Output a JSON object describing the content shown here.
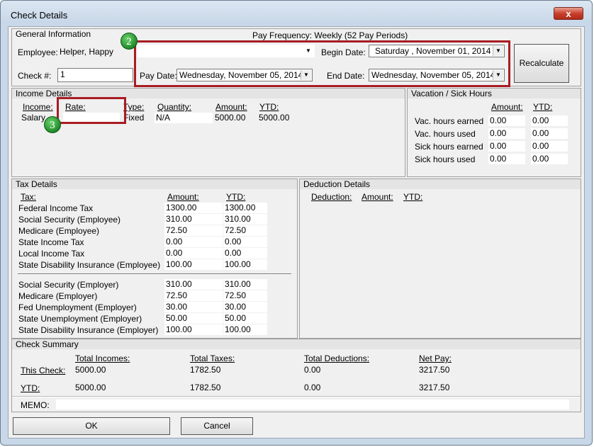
{
  "window": {
    "title": "Check Details",
    "close_glyph": "x"
  },
  "general": {
    "header": "General Information",
    "pay_frequency": "Pay Frequency: Weekly (52 Pay Periods)",
    "employee_label": "Employee:",
    "employee_value": "Helper, Happy",
    "check_label": "Check #:",
    "check_value": "1",
    "begin_date_label": "Begin Date:",
    "begin_date_value": "Saturday , November 01, 2014",
    "pay_date_label": "Pay Date:",
    "pay_date_value": "Wednesday, November 05, 2014",
    "end_date_label": "End Date:",
    "end_date_value": "Wednesday, November 05, 2014",
    "recalculate_label": "Recalculate"
  },
  "annotations": {
    "badge_2": "2",
    "badge_3": "3"
  },
  "income": {
    "header": "Income Details",
    "columns": {
      "income": "Income:",
      "rate": "Rate:",
      "type": "Type:",
      "quantity": "Quantity:",
      "amount": "Amount:",
      "ytd": "YTD:"
    },
    "row": {
      "income": "Salary",
      "rate": "",
      "type": "Fixed",
      "quantity": "N/A",
      "amount": "5000.00",
      "ytd": "5000.00"
    }
  },
  "vacation": {
    "header": "Vacation / Sick Hours",
    "columns": {
      "amount": "Amount:",
      "ytd": "YTD:"
    },
    "rows": [
      {
        "label": "Vac. hours earned",
        "amount": "0.00",
        "ytd": "0.00"
      },
      {
        "label": "Vac. hours used",
        "amount": "0.00",
        "ytd": "0.00"
      },
      {
        "label": "Sick hours earned",
        "amount": "0.00",
        "ytd": "0.00"
      },
      {
        "label": "Sick hours used",
        "amount": "0.00",
        "ytd": "0.00"
      }
    ]
  },
  "tax": {
    "header": "Tax Details",
    "columns": {
      "tax": "Tax:",
      "amount": "Amount:",
      "ytd": "YTD:"
    },
    "employee_rows": [
      {
        "label": "Federal Income Tax",
        "amount": "1300.00",
        "ytd": "1300.00"
      },
      {
        "label": "Social Security (Employee)",
        "amount": "310.00",
        "ytd": "310.00"
      },
      {
        "label": "Medicare (Employee)",
        "amount": "72.50",
        "ytd": "72.50"
      },
      {
        "label": "State Income Tax",
        "amount": "0.00",
        "ytd": "0.00"
      },
      {
        "label": "Local Income Tax",
        "amount": "0.00",
        "ytd": "0.00"
      },
      {
        "label": "State Disability Insurance (Employee)",
        "amount": "100.00",
        "ytd": "100.00"
      }
    ],
    "employer_rows": [
      {
        "label": "Social Security (Employer)",
        "amount": "310.00",
        "ytd": "310.00"
      },
      {
        "label": "Medicare (Employer)",
        "amount": "72.50",
        "ytd": "72.50"
      },
      {
        "label": "Fed Unemployment (Employer)",
        "amount": "30.00",
        "ytd": "30.00"
      },
      {
        "label": "State Unemployment (Employer)",
        "amount": "50.00",
        "ytd": "50.00"
      },
      {
        "label": "State Disability Insurance (Employer)",
        "amount": "100.00",
        "ytd": "100.00"
      }
    ]
  },
  "deduction": {
    "header": "Deduction Details",
    "columns": {
      "deduction": "Deduction:",
      "amount": "Amount:",
      "ytd": "YTD:"
    }
  },
  "summary": {
    "header": "Check Summary",
    "columns": {
      "incomes": "Total Incomes:",
      "taxes": "Total Taxes:",
      "deductions": "Total Deductions:",
      "net": "Net Pay:"
    },
    "this_check": {
      "label": "This Check:",
      "incomes": "5000.00",
      "taxes": "1782.50",
      "deductions": "0.00",
      "net": "3217.50"
    },
    "ytd": {
      "label": "YTD:",
      "incomes": "5000.00",
      "taxes": "1782.50",
      "deductions": "0.00",
      "net": "3217.50"
    },
    "memo_label": "MEMO:",
    "memo_value": ""
  },
  "buttons": {
    "ok": "OK",
    "cancel": "Cancel"
  },
  "colors": {
    "annotation_red": "#a81c22",
    "badge_green": "#1f8a2a"
  }
}
